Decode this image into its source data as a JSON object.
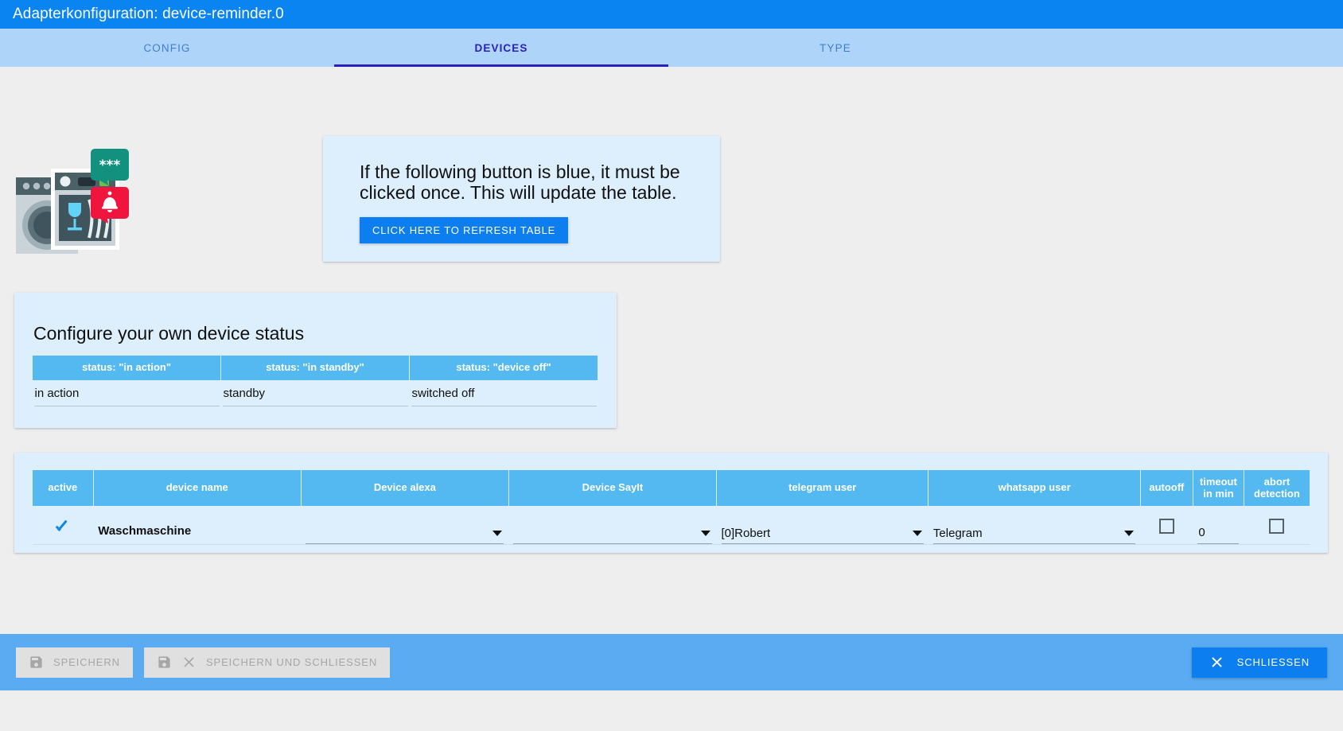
{
  "window": {
    "title": "Adapterkonfiguration: device-reminder.0"
  },
  "tabs": [
    {
      "label": "CONFIG",
      "active": false
    },
    {
      "label": "DEVICES",
      "active": true
    },
    {
      "label": "TYPE",
      "active": false
    }
  ],
  "logo": {
    "name": "device-reminder-logo",
    "alt": "washing machine and dishwasher with notification bubbles"
  },
  "refresh_card": {
    "text": "If the following button is blue, it must be clicked once. This will update the table.",
    "button_label": "CLICK HERE TO REFRESH TABLE",
    "button_color": "#0c7ef0"
  },
  "status_section": {
    "title": "Configure your own device status",
    "headers": [
      "status: \"in action\"",
      "status: \"in standby\"",
      "status: \"device off\""
    ],
    "values": [
      "in action",
      "standby",
      "switched off"
    ],
    "header_color": "#53b9f0"
  },
  "device_table": {
    "headers": [
      "active",
      "device name",
      "Device alexa",
      "Device SayIt",
      "telegram user",
      "whatsapp user",
      "autooff",
      "timeout\nin min",
      "abort\ndetection"
    ],
    "header_autooff": "autooff",
    "header_timeout_line1": "timeout",
    "header_timeout_line2": "in min",
    "header_abort_line1": "abort",
    "header_abort_line2": "detection",
    "rows": [
      {
        "active": true,
        "device_name": "Waschmaschine",
        "device_alexa": "",
        "device_sayit": "",
        "telegram_user": "[0]Robert",
        "whatsapp_user": "Telegram",
        "autooff": false,
        "timeout_in_min": "0",
        "abort_detection": false
      }
    ]
  },
  "bottom_bar": {
    "save_label": "SPEICHERN",
    "save_close_label": "SPEICHERN UND SCHLIESSEN",
    "close_label": "SCHLIESSEN",
    "bar_color": "#5aabf2"
  }
}
